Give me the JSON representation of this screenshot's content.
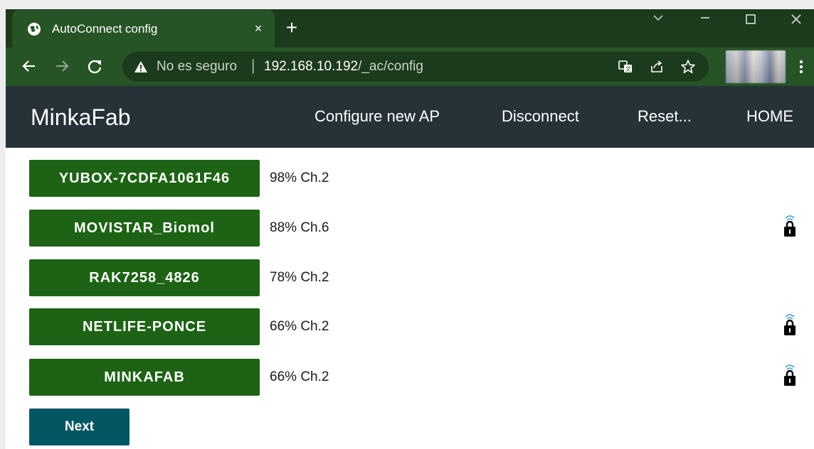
{
  "browser": {
    "tab": {
      "title": "AutoConnect config",
      "close_label": "×"
    },
    "new_tab_label": "+",
    "window_controls": {
      "tab_search_icon": "chevron-down-icon",
      "minimize_icon": "minimize-icon",
      "maximize_icon": "maximize-icon",
      "close_icon": "close-icon"
    },
    "address_bar": {
      "security_label": "No es seguro",
      "separator": "|",
      "host": "192.168.10.192",
      "path": "/_ac/config"
    },
    "toolbar_icons": [
      "back-icon",
      "forward-icon",
      "reload-icon",
      "translate-icon",
      "share-icon",
      "bookmark-star-icon",
      "menu-icon"
    ]
  },
  "app": {
    "title": "MinkaFab",
    "menu": [
      {
        "label": "Configure new AP"
      },
      {
        "label": "Disconnect"
      },
      {
        "label": "Reset..."
      },
      {
        "label": "HOME"
      }
    ],
    "access_points": [
      {
        "ssid": "YUBOX-7CDFA1061F46",
        "signal": "98%",
        "channel": "Ch.2",
        "secured": false
      },
      {
        "ssid": "MOVISTAR_Biomol",
        "signal": "88%",
        "channel": "Ch.6",
        "secured": true
      },
      {
        "ssid": "RAK7258_4826",
        "signal": "78%",
        "channel": "Ch.2",
        "secured": false
      },
      {
        "ssid": "NETLIFE-PONCE",
        "signal": "66%",
        "channel": "Ch.2",
        "secured": true
      },
      {
        "ssid": "MINKAFAB",
        "signal": "66%",
        "channel": "Ch.2",
        "secured": true
      }
    ],
    "next_label": "Next"
  },
  "colors": {
    "tabstrip": "#1c3a1c",
    "toolbar": "#265426",
    "app_header": "#263238",
    "ssid_button": "#1e6315",
    "next_button": "#035763"
  }
}
